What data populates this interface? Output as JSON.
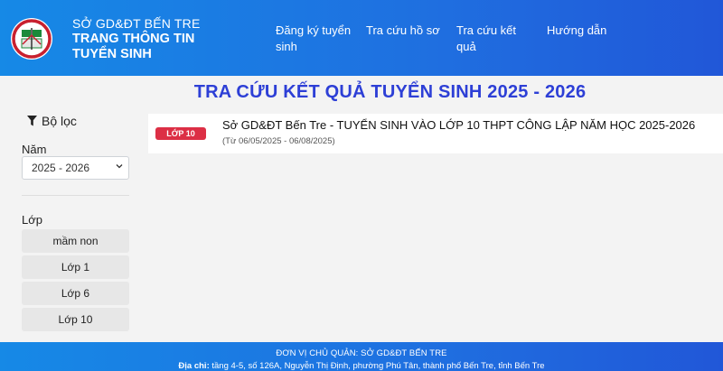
{
  "header": {
    "brand_line1": "SỞ GD&ĐT BẾN TRE",
    "brand_line2": "TRANG THÔNG TIN TUYỂN SINH",
    "nav": [
      {
        "label": "Đăng ký tuyển sinh"
      },
      {
        "label": "Tra cứu hồ sơ"
      },
      {
        "label": "Tra cứu kết quả"
      },
      {
        "label": "Hướng dẫn"
      }
    ]
  },
  "page_title": "TRA CỨU KẾT QUẢ TUYỂN SINH 2025 - 2026",
  "sidebar": {
    "filter_title": "Bộ lọc",
    "year_label": "Năm",
    "year_selected": "2025 - 2026",
    "class_label": "Lớp",
    "classes": [
      {
        "label": "mầm non"
      },
      {
        "label": "Lớp 1"
      },
      {
        "label": "Lớp 6"
      },
      {
        "label": "Lớp 10"
      }
    ]
  },
  "results": [
    {
      "badge": "LỚP 10",
      "title": "Sở GD&ĐT Bến Tre - TUYỂN SINH VÀO LỚP 10 THPT CÔNG LẬP NĂM HỌC 2025-2026",
      "date_range": "(Từ 06/05/2025 - 06/08/2025)"
    }
  ],
  "footer": {
    "owner": "ĐƠN VỊ CHỦ QUẢN: SỞ GD&ĐT BẾN TRE",
    "address_label": "Địa chỉ:",
    "address": "tầng 4-5, số 126A, Nguyễn Thị Định, phường Phú Tân, thành phố Bến Tre, tỉnh Bến Tre"
  },
  "colors": {
    "header_bg": "#1f6fe0",
    "title": "#2d3fd6",
    "badge": "#dc2f45"
  },
  "icons": {
    "logo": "department-logo",
    "filter": "funnel-icon",
    "select": "chevron-down-icon"
  }
}
